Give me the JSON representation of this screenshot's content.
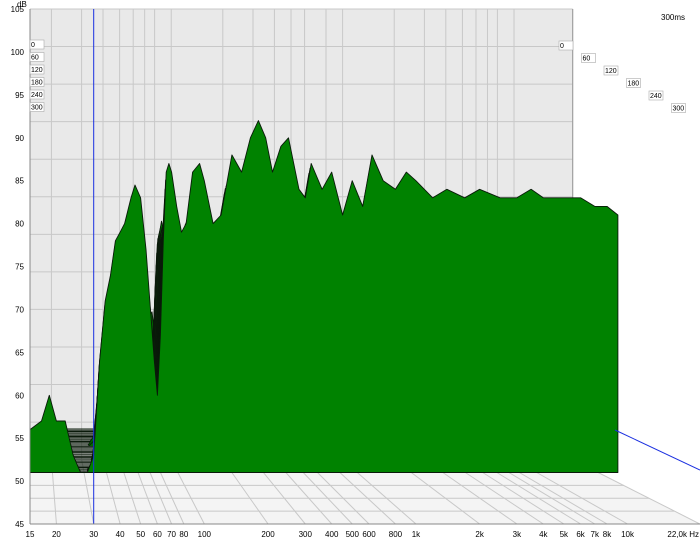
{
  "chart_data": {
    "type": "area",
    "style": "waterfall",
    "y_unit": "dB",
    "x_unit": "Hz",
    "time_unit": "ms",
    "ylim": [
      45,
      105
    ],
    "xlim": [
      15,
      22000
    ],
    "x_scale": "log",
    "grid": true,
    "y_ticks": [
      "45",
      "50",
      "55",
      "60",
      "65",
      "70",
      "75",
      "80",
      "85",
      "90",
      "95",
      "100",
      "105"
    ],
    "x_ticks": [
      {
        "v": 15,
        "label": "15"
      },
      {
        "v": 20,
        "label": "20"
      },
      {
        "v": 30,
        "label": "30"
      },
      {
        "v": 40,
        "label": "40"
      },
      {
        "v": 50,
        "label": "50"
      },
      {
        "v": 60,
        "label": "60"
      },
      {
        "v": 70,
        "label": "70"
      },
      {
        "v": 80,
        "label": "80"
      },
      {
        "v": 100,
        "label": "100"
      },
      {
        "v": 200,
        "label": "200"
      },
      {
        "v": 300,
        "label": "300"
      },
      {
        "v": 400,
        "label": "400"
      },
      {
        "v": 500,
        "label": "500"
      },
      {
        "v": 600,
        "label": "600"
      },
      {
        "v": 800,
        "label": "800"
      },
      {
        "v": 1000,
        "label": "1k"
      },
      {
        "v": 2000,
        "label": "2k"
      },
      {
        "v": 3000,
        "label": "3k"
      },
      {
        "v": 4000,
        "label": "4k"
      },
      {
        "v": 5000,
        "label": "5k"
      },
      {
        "v": 6000,
        "label": "6k"
      },
      {
        "v": 7000,
        "label": "7k"
      },
      {
        "v": 8000,
        "label": "8k"
      },
      {
        "v": 10000,
        "label": "10k"
      },
      {
        "v": 22000,
        "label": "22,0k Hz"
      }
    ],
    "time_ticks": [
      "0",
      "60",
      "120",
      "180",
      "240",
      "300"
    ],
    "time_end_label": "300ms",
    "cursor_x": 30,
    "front_slice": {
      "time_ms": 0,
      "points": [
        [
          15,
          56
        ],
        [
          17,
          57
        ],
        [
          18.5,
          60
        ],
        [
          20,
          57
        ],
        [
          22,
          57
        ],
        [
          24,
          53
        ],
        [
          26,
          47
        ],
        [
          28,
          46
        ],
        [
          30,
          53
        ],
        [
          32,
          64
        ],
        [
          34,
          71
        ],
        [
          36,
          74
        ],
        [
          38,
          78
        ],
        [
          40,
          79
        ],
        [
          42,
          80
        ],
        [
          45,
          83
        ],
        [
          47,
          84.5
        ],
        [
          50,
          83
        ],
        [
          53,
          77
        ],
        [
          56,
          69
        ],
        [
          58,
          64
        ],
        [
          60,
          60
        ],
        [
          62,
          67
        ],
        [
          64,
          78
        ],
        [
          66,
          86
        ],
        [
          68,
          87
        ],
        [
          70,
          86
        ],
        [
          74,
          82
        ],
        [
          78,
          79
        ],
        [
          82,
          80
        ],
        [
          88,
          86
        ],
        [
          95,
          87
        ],
        [
          100,
          85
        ],
        [
          110,
          80
        ],
        [
          120,
          81
        ],
        [
          135,
          88
        ],
        [
          150,
          86
        ],
        [
          165,
          90
        ],
        [
          180,
          92
        ],
        [
          195,
          90
        ],
        [
          210,
          86
        ],
        [
          230,
          89
        ],
        [
          250,
          90
        ],
        [
          280,
          84
        ],
        [
          300,
          83
        ],
        [
          320,
          87
        ],
        [
          360,
          84
        ],
        [
          400,
          86
        ],
        [
          450,
          81
        ],
        [
          500,
          85
        ],
        [
          560,
          82
        ],
        [
          620,
          88
        ],
        [
          700,
          85
        ],
        [
          800,
          84
        ],
        [
          900,
          86
        ],
        [
          1000,
          85
        ],
        [
          1200,
          83
        ],
        [
          1400,
          84
        ],
        [
          1700,
          83
        ],
        [
          2000,
          84
        ],
        [
          2500,
          83
        ],
        [
          3000,
          83
        ],
        [
          3500,
          84
        ],
        [
          4000,
          83
        ],
        [
          5000,
          83
        ],
        [
          6000,
          83
        ],
        [
          7000,
          82
        ],
        [
          8000,
          82
        ],
        [
          9000,
          81
        ]
      ]
    }
  }
}
